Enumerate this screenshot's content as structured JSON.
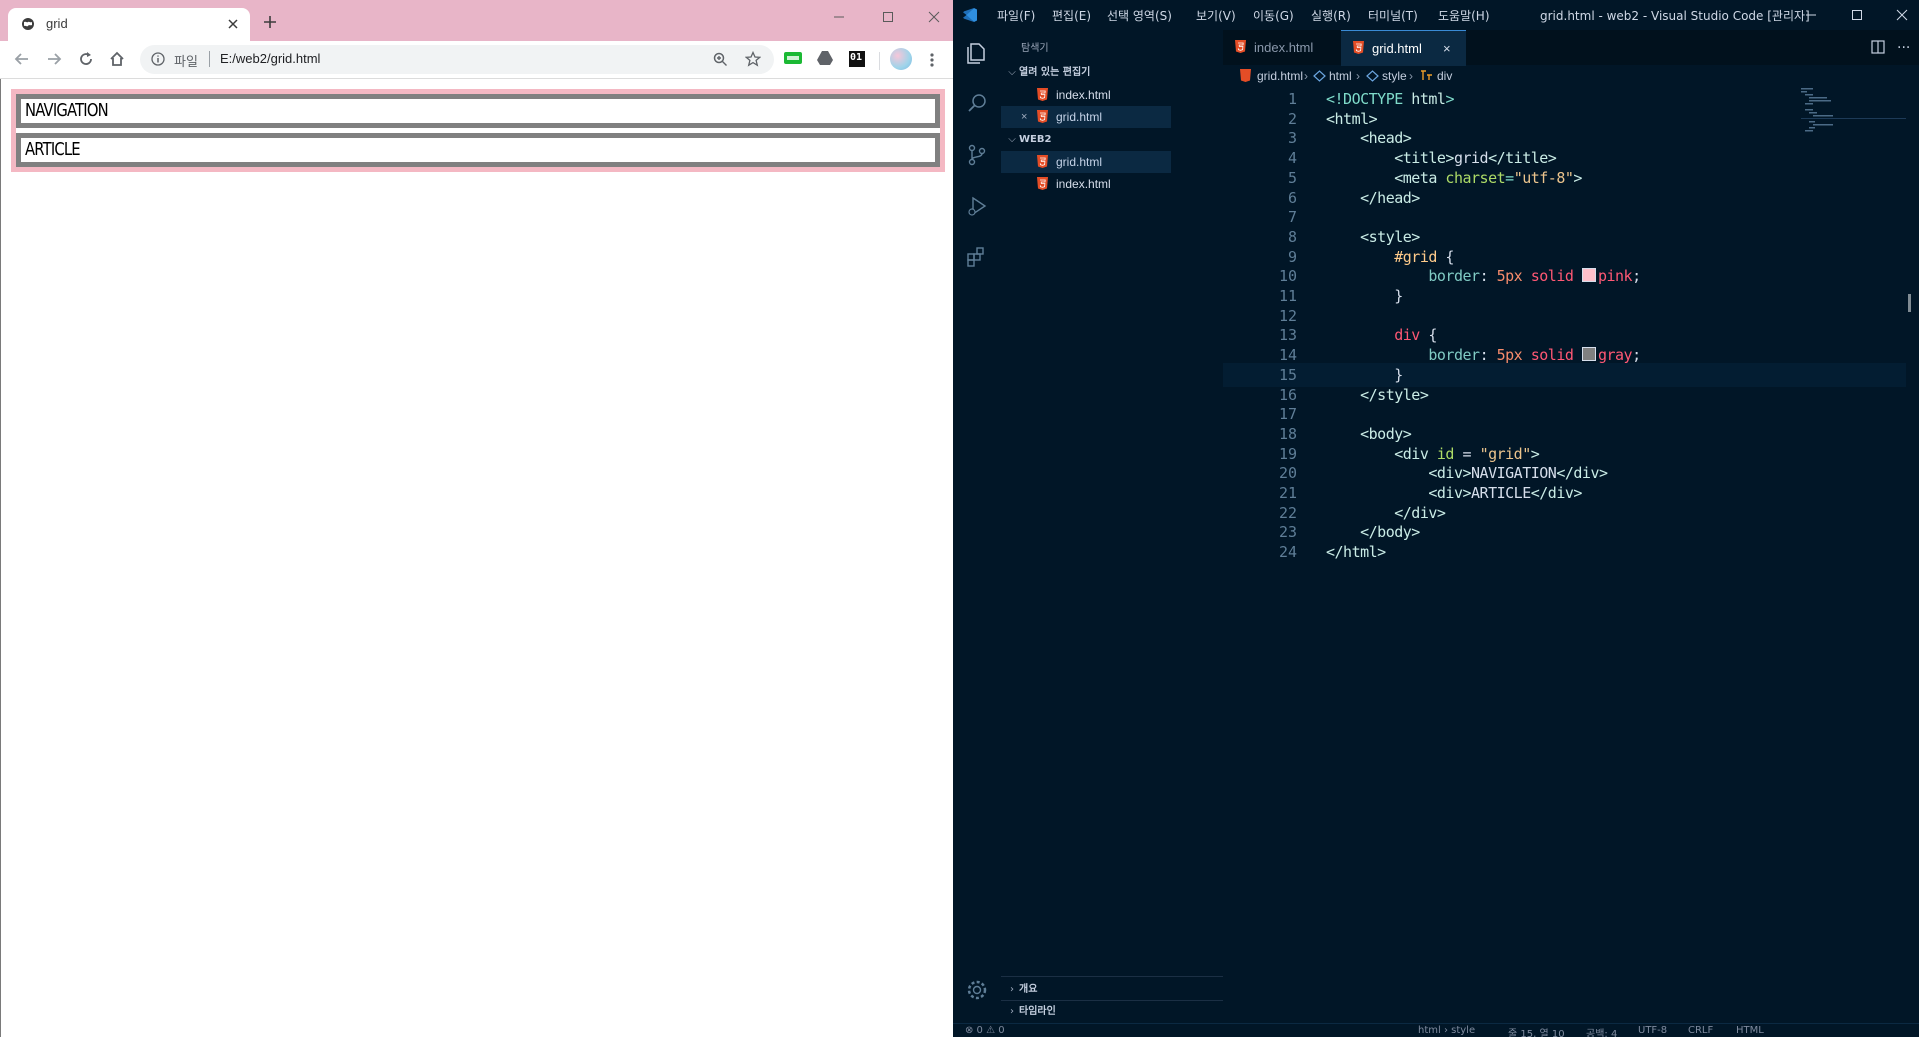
{
  "browser": {
    "tab_title": "grid",
    "address_scheme": "파일",
    "address_url": "E:/web2/grid.html",
    "extension_badge": "01",
    "page": {
      "nav_label": "NAVIGATION",
      "article_label": "ARTICLE"
    },
    "colors": {
      "tab_strip": "#e8b5c8",
      "outer_border": "#f4b8c3",
      "inner_border": "#808080"
    }
  },
  "vscode": {
    "menu": [
      "파일(F)",
      "편집(E)",
      "선택 영역(S)",
      "보기(V)",
      "이동(G)",
      "실행(R)",
      "터미널(T)",
      "도움말(H)"
    ],
    "window_title": "grid.html - web2 - Visual Studio Code [관리자]",
    "sidebar": {
      "title": "탐색기",
      "open_editors_label": "열려 있는 편집기",
      "open_editors": [
        {
          "name": "index.html",
          "close": ""
        },
        {
          "name": "grid.html",
          "close": "×"
        }
      ],
      "folder_label": "WEB2",
      "folder_files": [
        {
          "name": "grid.html"
        },
        {
          "name": "index.html"
        }
      ],
      "outline_label": "개요",
      "timeline_label": "타임라인"
    },
    "tabs": [
      {
        "label": "index.html"
      },
      {
        "label": "grid.html",
        "close": "×"
      }
    ],
    "breadcrumb": [
      "grid.html",
      "html",
      "style",
      "div"
    ],
    "line_numbers": [
      "1",
      "2",
      "3",
      "4",
      "5",
      "6",
      "7",
      "8",
      "9",
      "10",
      "11",
      "12",
      "13",
      "14",
      "15",
      "16",
      "17",
      "18",
      "19",
      "20",
      "21",
      "22",
      "23",
      "24"
    ],
    "code": {
      "l1": [
        "<!DOCTYPE",
        " html",
        ">"
      ],
      "l2": [
        "<html>"
      ],
      "l3": [
        "<head>"
      ],
      "l4": [
        "<title>",
        "grid",
        "</title>"
      ],
      "l5": [
        "<meta",
        " charset",
        "=",
        "\"utf-8\"",
        ">"
      ],
      "l6": [
        "</head>"
      ],
      "l8": [
        "<style>"
      ],
      "l9": [
        "#grid",
        " {"
      ],
      "l10": [
        "border",
        ": ",
        "5px",
        " solid ",
        "pink",
        ";"
      ],
      "l11": [
        "}"
      ],
      "l13": [
        "div",
        " {"
      ],
      "l14": [
        "border",
        ": ",
        "5px",
        " solid ",
        "gray",
        ";"
      ],
      "l15": [
        "}"
      ],
      "l16": [
        "</style>"
      ],
      "l18": [
        "<body>"
      ],
      "l19": [
        "<div",
        " id",
        " = ",
        "\"grid\"",
        ">"
      ],
      "l20": [
        "<div>",
        "NAVIGATION",
        "</div>"
      ],
      "l21": [
        "<div>",
        "ARTICLE",
        "</div>"
      ],
      "l22": [
        "</div>"
      ],
      "l23": [
        "</body>"
      ],
      "l24": [
        "</html>"
      ]
    },
    "swatches": {
      "pink": "#ffc0cb",
      "gray": "#808080"
    },
    "statusbar": {
      "problems": "⊗ 0 ⚠ 0",
      "language_context": "html › style",
      "cursor": "줄 15, 열 10",
      "spaces": "공백: 4",
      "encoding": "UTF-8",
      "eol": "CRLF",
      "language": "HTML"
    },
    "colors": {
      "background": "#011627",
      "active_tab_border": "#3a8bd6"
    }
  }
}
